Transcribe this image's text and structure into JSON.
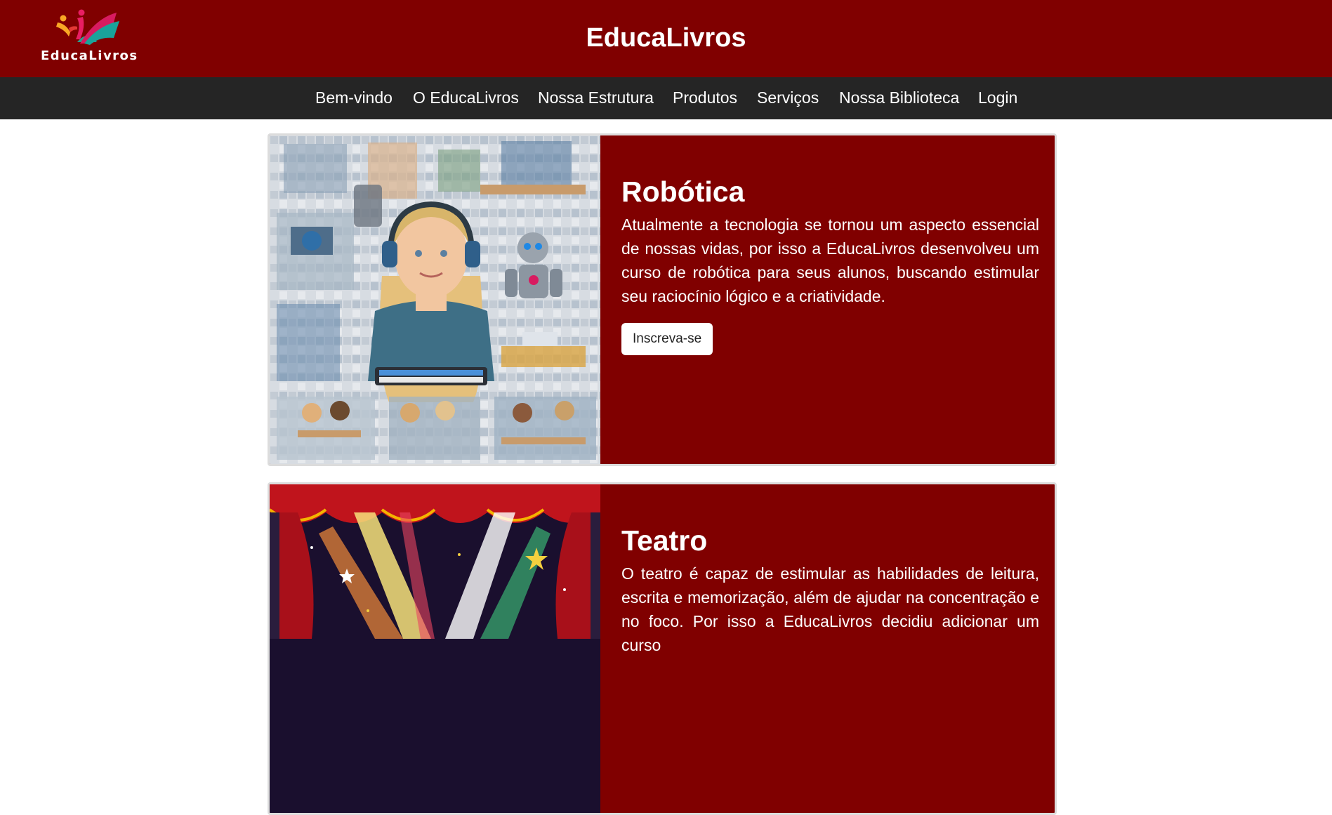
{
  "header": {
    "logo_text": "EducaLivros",
    "title": "EducaLivros"
  },
  "nav": {
    "items": [
      {
        "label": "Bem-vindo"
      },
      {
        "label": "O EducaLivros"
      },
      {
        "label": "Nossa Estrutura"
      },
      {
        "label": "Produtos"
      },
      {
        "label": "Serviços"
      },
      {
        "label": "Nossa Biblioteca"
      },
      {
        "label": "Login"
      }
    ]
  },
  "courses": [
    {
      "title": "Robótica",
      "text": "Atualmente a tecnologia se tornou um aspecto essencial de nossas vidas, por isso a EducaLivros desenvolveu um curso de robótica para seus alunos, buscando estimular seu raciocínio lógico e a criatividade.",
      "button": "Inscreva-se"
    },
    {
      "title": "Teatro",
      "text": "O teatro é capaz de estimular as habilidades de leitura, escrita e memorização, além de ajudar na concentração e no foco. Por isso a EducaLivros decidiu adicionar um curso"
    }
  ],
  "colors": {
    "brand": "#800000",
    "nav_background": "#252525",
    "text_on_brand": "#ffffff"
  }
}
